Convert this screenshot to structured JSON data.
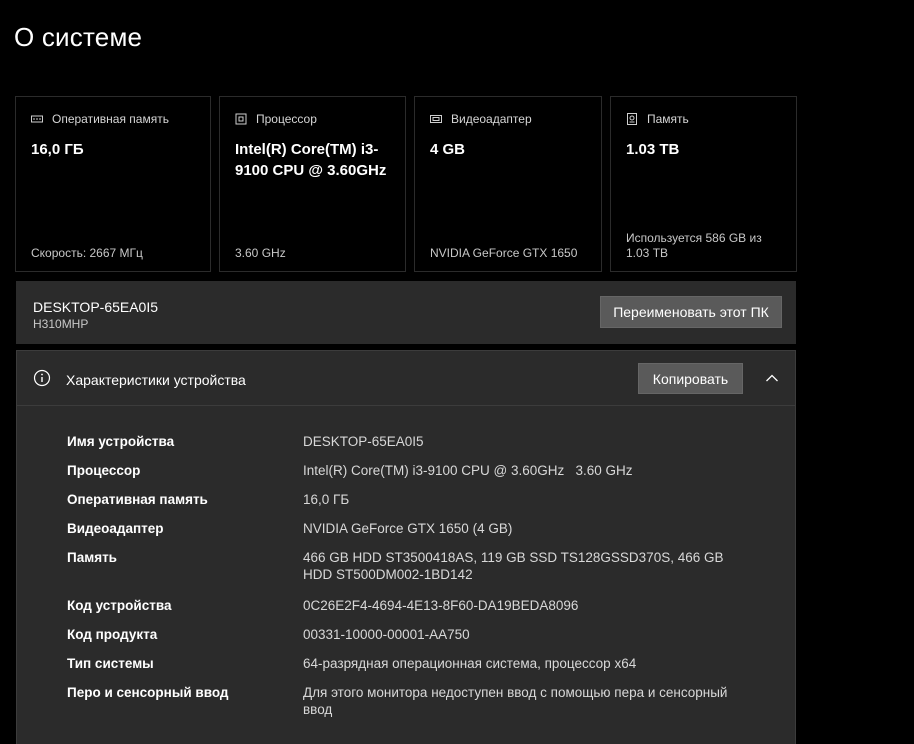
{
  "page": {
    "title": "О системе"
  },
  "cards": [
    {
      "icon": "ram-icon",
      "label": "Оперативная память",
      "value": "16,0 ГБ",
      "foot": "Скорость: 2667 МГц"
    },
    {
      "icon": "cpu-icon",
      "label": "Процессор",
      "value": "Intel(R) Core(TM) i3-9100 CPU @ 3.60GHz",
      "foot": "3.60 GHz"
    },
    {
      "icon": "gpu-icon",
      "label": "Видеоадаптер",
      "value": "4 GB",
      "foot": "NVIDIA GeForce GTX 1650"
    },
    {
      "icon": "storage-icon",
      "label": "Память",
      "value": "1.03 TB",
      "foot": "Используется 586 GB из 1.03 TB"
    }
  ],
  "pc": {
    "name": "DESKTOP-65EA0I5",
    "model": "H310MHP",
    "rename_label": "Переименовать этот ПК"
  },
  "specs": {
    "icon": "info-icon",
    "title": "Характеристики устройства",
    "copy_label": "Копировать",
    "toggle_icon": "chevron-up-icon",
    "rows": [
      {
        "key": "Имя устройства",
        "value": "DESKTOP-65EA0I5"
      },
      {
        "key": "Процессор",
        "value": "Intel(R) Core(TM) i3-9100 CPU @ 3.60GHz   3.60 GHz"
      },
      {
        "key": "Оперативная память",
        "value": "16,0 ГБ"
      },
      {
        "key": "Видеоадаптер",
        "value": "NVIDIA GeForce GTX 1650 (4 GB)"
      },
      {
        "key": "Память",
        "value": "466 GB HDD ST3500418AS, 119 GB SSD TS128GSSD370S, 466 GB HDD ST500DM002-1BD142"
      },
      {
        "key": "Код устройства",
        "value": "0C26E2F4-4694-4E13-8F60-DA19BEDA8096"
      },
      {
        "key": "Код продукта",
        "value": "00331-10000-00001-AA750"
      },
      {
        "key": "Тип системы",
        "value": "64-разрядная операционная система, процессор x64"
      },
      {
        "key": "Перо и сенсорный ввод",
        "value": "Для этого монитора недоступен ввод с помощью пера и сенсорный ввод"
      }
    ]
  }
}
